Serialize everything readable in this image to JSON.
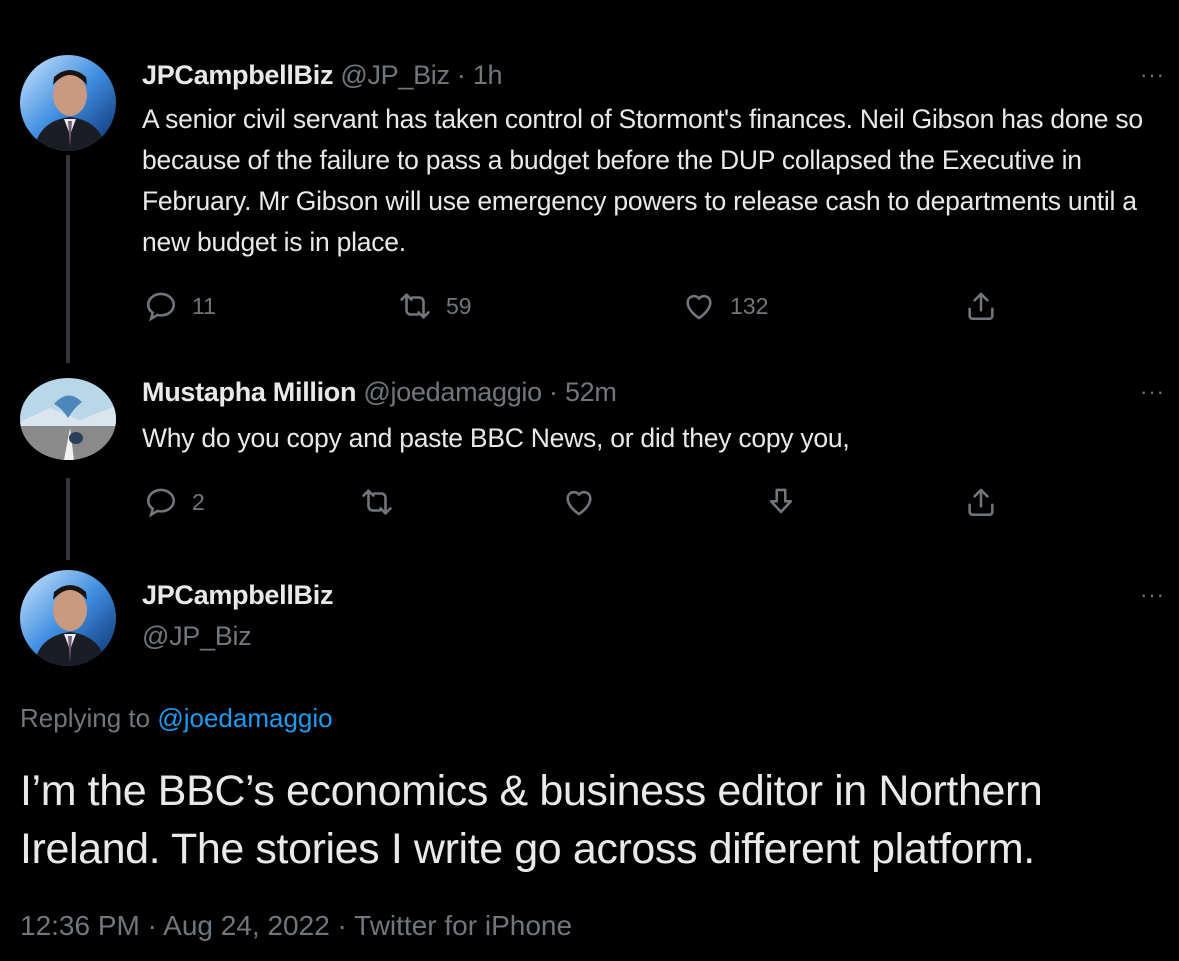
{
  "tweet1": {
    "display_name": "JPCampbellBiz",
    "handle": "@JP_Biz",
    "separator": "·",
    "time": "1h",
    "text": "A senior civil servant has taken control of Stormont's finances. Neil Gibson has done so because of the failure to pass a budget before the DUP collapsed the Executive in February. Mr Gibson will use emergency powers to release cash to departments until a new budget is in place.",
    "more": "···",
    "replies": "11",
    "retweets": "59",
    "likes": "132"
  },
  "tweet2": {
    "display_name": "Mustapha Million",
    "handle": "@joedamaggio",
    "separator": "·",
    "time": "52m",
    "text": "Why do you copy and paste BBC News, or did they copy you,",
    "more": "···",
    "replies": "2"
  },
  "main_tweet": {
    "display_name": "JPCampbellBiz",
    "handle": "@JP_Biz",
    "more": "···",
    "replying_prefix": "Replying to ",
    "replying_handle": "@joedamaggio",
    "text": "I’m the BBC’s economics & business editor in Northern Ireland. The stories I write go across different platform.",
    "timestamp": "12:36 PM · Aug 24, 2022 · Twitter for iPhone"
  },
  "colors": {
    "background": "#000000",
    "text": "#e7e9ea",
    "muted": "#71767b",
    "link": "#1d9bf0",
    "thread_line": "#333639"
  },
  "icons": {
    "reply": "reply-icon",
    "retweet": "retweet-icon",
    "like": "heart-icon",
    "share": "share-icon",
    "download": "download-icon"
  }
}
